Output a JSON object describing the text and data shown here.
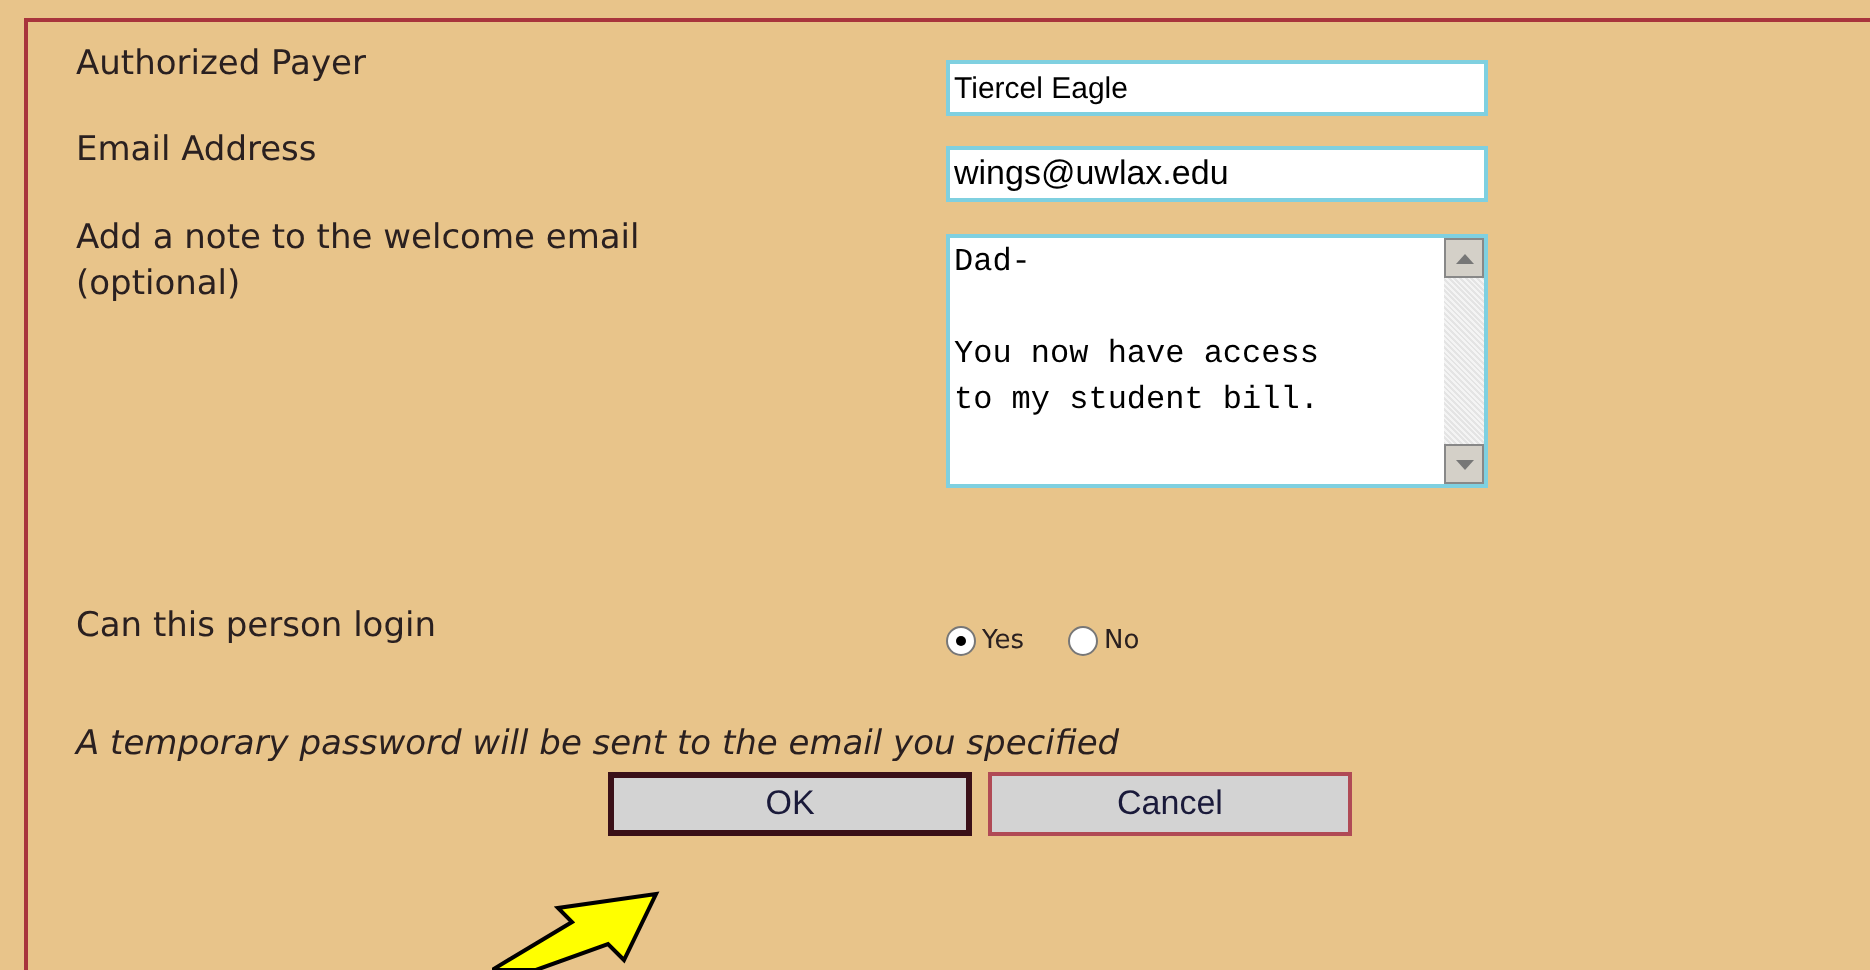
{
  "fields": [
    {
      "kind": "text",
      "label": "Authorized Payer",
      "value": "Tiercel Eagle"
    },
    {
      "kind": "email",
      "label": "Email Address",
      "value": "wings@uwlax.edu"
    },
    {
      "kind": "note",
      "label": "Add a note to the welcome email (optional)",
      "value": "Dad-\n\nYou now have access\nto my student bill."
    }
  ],
  "login": {
    "label": "Can this person login",
    "options": [
      {
        "label": "Yes",
        "selected": true
      },
      {
        "label": "No",
        "selected": false
      }
    ]
  },
  "notice": "A temporary password will be sent to the email you specified",
  "buttons": [
    {
      "label": "OK",
      "focused": true
    },
    {
      "label": "Cancel",
      "focused": false
    }
  ]
}
